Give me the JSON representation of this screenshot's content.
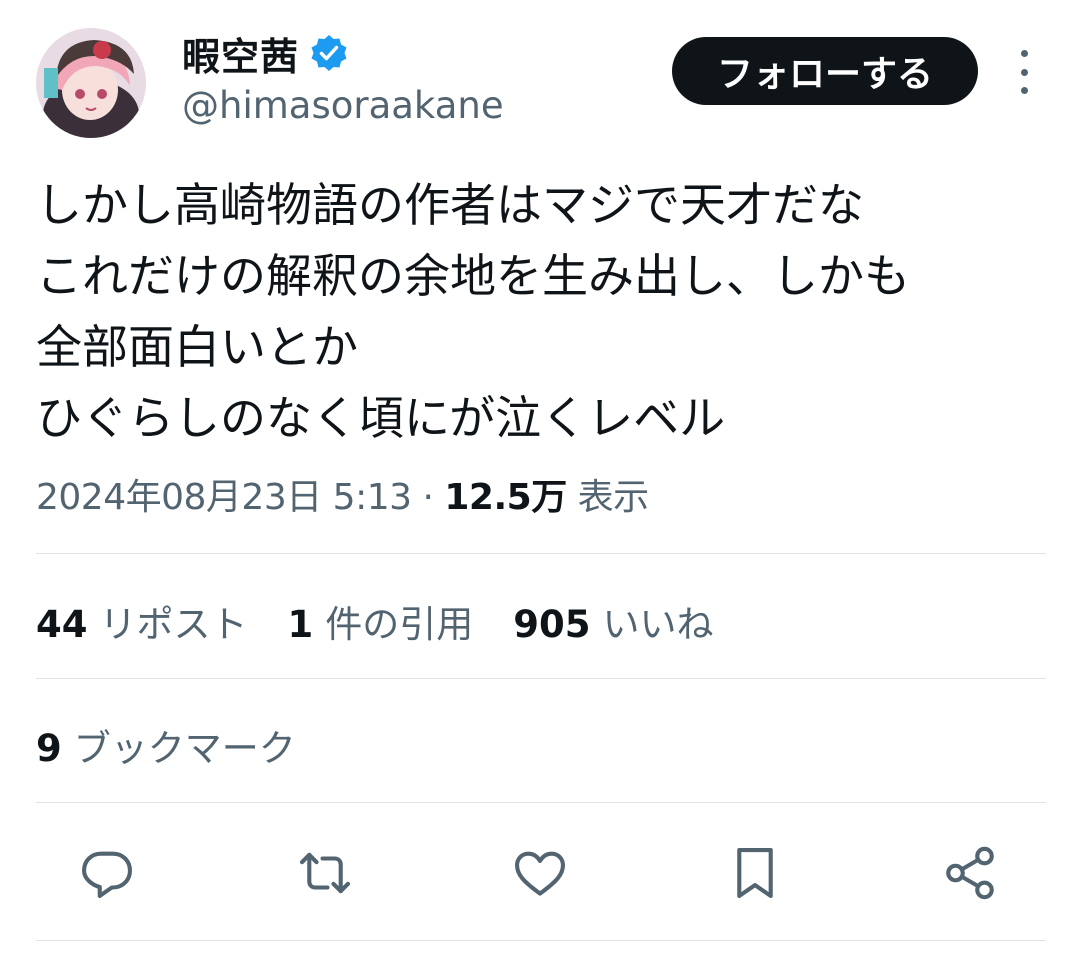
{
  "tweet": {
    "author": {
      "display_name": "暇空茜",
      "handle": "@himasoraakane",
      "verified": true
    },
    "follow_label": "フォローする",
    "body_lines": [
      "しかし高崎物語の作者はマジで天才だな",
      "これだけの解釈の余地を生み出し、しかも",
      "全部面白いとか",
      "ひぐらしのなく頃にが泣くレベル"
    ],
    "meta": {
      "timestamp": "2024年08月23日 5:13",
      "separator": " · ",
      "views_count": "12.5万",
      "views_label": "表示"
    },
    "stats": [
      {
        "count": "44",
        "label": "リポスト"
      },
      {
        "count": "1",
        "label": "件の引用"
      },
      {
        "count": "905",
        "label": "いいね"
      }
    ],
    "bookmarks": {
      "count": "9",
      "label": "ブックマーク"
    }
  },
  "colors": {
    "text_primary": "#0f1419",
    "text_secondary": "#536471",
    "verified_blue": "#1d9bf0",
    "divider": "#dfe3e6",
    "follow_bg": "#0f1419"
  },
  "icons": {
    "reply": "reply-icon",
    "repost": "repost-icon",
    "like": "heart-icon",
    "bookmark": "bookmark-icon",
    "share": "share-icon",
    "more": "more-icon",
    "verified": "verified-badge-icon"
  }
}
